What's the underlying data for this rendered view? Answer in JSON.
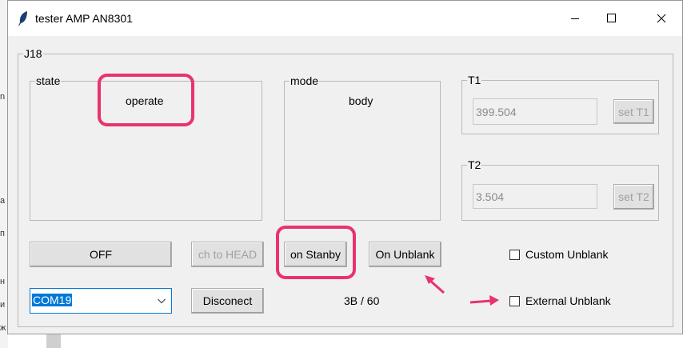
{
  "window": {
    "title": "tester AMP AN8301"
  },
  "frame": {
    "label": "J18"
  },
  "state": {
    "label": "state",
    "value": "operate"
  },
  "mode": {
    "label": "mode",
    "value": "body"
  },
  "t1": {
    "label": "T1",
    "value": "399.504",
    "button": "set T1"
  },
  "t2": {
    "label": "T2",
    "value": "3.504",
    "button": "set T2"
  },
  "buttons": {
    "off": "OFF",
    "ch_to_head": "ch to HEAD",
    "on_stanby": "on Stanby",
    "on_unblank": "On Unblank",
    "disconnect": "Disconect"
  },
  "port": {
    "selected": "COM19"
  },
  "counter": "3B / 60",
  "checkboxes": {
    "custom": "Custom Unblank",
    "external": "External Unblank"
  },
  "background_chars": [
    "n",
    "a",
    "п",
    "н",
    "и",
    "ж"
  ],
  "colors": {
    "highlight": "#e8336c",
    "selection": "#0078d7"
  }
}
